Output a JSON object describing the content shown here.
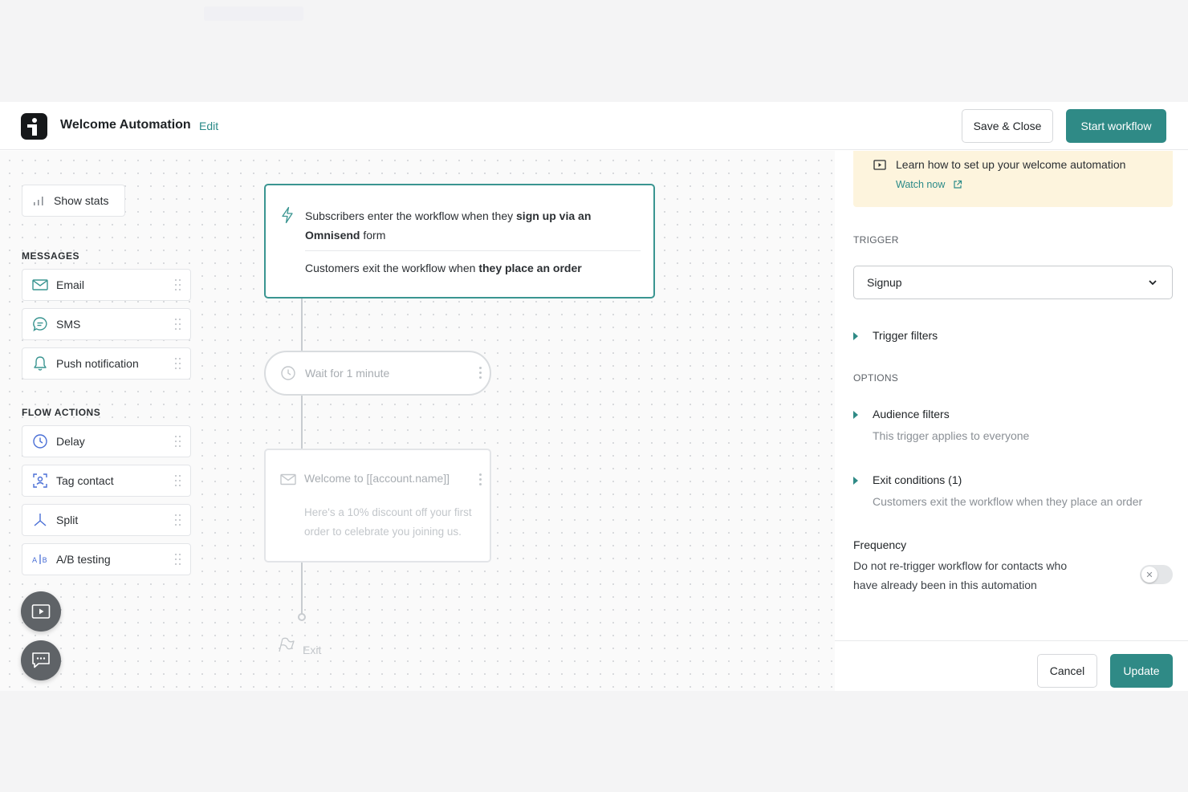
{
  "header": {
    "title": "Welcome Automation",
    "edit_label": "Edit",
    "save_close_label": "Save & Close",
    "start_label": "Start workflow"
  },
  "sidebar": {
    "show_stats_label": "Show stats",
    "messages_heading": "MESSAGES",
    "messages": [
      {
        "label": "Email",
        "icon": "mail-icon"
      },
      {
        "label": "SMS",
        "icon": "chat-bubble-icon"
      },
      {
        "label": "Push notification",
        "icon": "bell-icon"
      }
    ],
    "flow_actions_heading": "FLOW ACTIONS",
    "flow_actions": [
      {
        "label": "Delay",
        "icon": "clock-icon"
      },
      {
        "label": "Tag contact",
        "icon": "tag-user-icon"
      },
      {
        "label": "Split",
        "icon": "split-icon"
      },
      {
        "label": "A/B testing",
        "icon": "ab-test-icon"
      }
    ]
  },
  "flow": {
    "trigger": {
      "enter_prefix": "Subscribers enter the workflow when they ",
      "enter_bold": "sign up via an Omnisend",
      "enter_suffix": " form",
      "exit_prefix": "Customers exit the workflow when ",
      "exit_bold": "they place an order"
    },
    "wait_label": "Wait for 1 minute",
    "email": {
      "subject": "Welcome to [[account.name]]",
      "body": "Here's a 10% discount off your first order to celebrate you joining us."
    },
    "exit_label": "Exit"
  },
  "panel": {
    "info_title": "Learn how to set up your welcome automation",
    "watch_now": "Watch now",
    "trigger_heading": "TRIGGER",
    "trigger_value": "Signup",
    "trigger_filters": "Trigger filters",
    "options_heading": "OPTIONS",
    "audience_filters": "Audience filters",
    "audience_sub": "This trigger applies to everyone",
    "exit_conditions": "Exit conditions (1)",
    "exit_sub": "Customers exit the workflow when they place an order",
    "frequency_title": "Frequency",
    "frequency_desc": "Do not re-trigger workflow for contacts who have already been in this automation",
    "frequency_enabled": false,
    "cancel_label": "Cancel",
    "update_label": "Update"
  },
  "colors": {
    "accent": "#2f8a86",
    "info_bg": "#fdf4dd"
  }
}
